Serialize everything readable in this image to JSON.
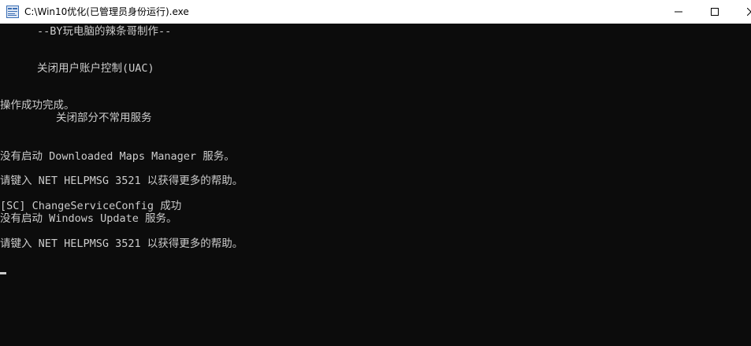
{
  "window": {
    "title": "C:\\Win10优化(已管理员身份运行).exe",
    "icon": "cmd-app-icon"
  },
  "caption_buttons": {
    "minimize": "minimize-icon",
    "maximize": "maximize-icon",
    "close": "close-icon"
  },
  "console": {
    "lines": [
      "--BY玩电脑的辣条哥制作--",
      "关闭用户账户控制(UAC)",
      "操作成功完成。",
      "关闭部分不常用服务",
      "没有启动 Downloaded Maps Manager 服务。",
      "请键入 NET HELPMSG 3521 以获得更多的帮助。",
      "[SC] ChangeServiceConfig 成功",
      "没有启动 Windows Update 服务。",
      "请键入 NET HELPMSG 3521 以获得更多的帮助。"
    ]
  },
  "colors": {
    "background": "#0c0c0c",
    "foreground": "#cccccc",
    "titlebar": "#ffffff"
  }
}
